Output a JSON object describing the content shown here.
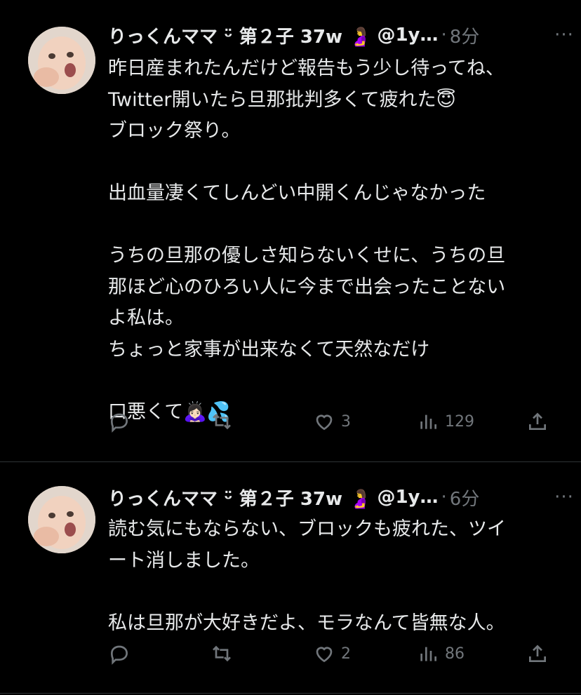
{
  "tweets": [
    {
      "name": "りっくんママ ᵕ̈ 第２子 37w 🤰",
      "handle": "@1y…",
      "dot": "·",
      "time": "8分",
      "more": "···",
      "lines": [
        "昨日産まれたんだけど報告もう少し待ってね、",
        "Twitter開いたら旦那批判多くて疲れた😇",
        "ブロック祭り。",
        "",
        "出血量凄くてしんどい中開くんじゃなかった",
        "",
        "うちの旦那の優しさ知らないくせに、うちの旦",
        "那ほど心のひろい人に今まで出会ったことない",
        "よ私は。",
        "ちょっと家事が出来なくて天然なだけ",
        "",
        "口悪くて🙇🏻‍♀️💦"
      ],
      "replies": "",
      "retweets": "",
      "likes": "3",
      "views": "129"
    },
    {
      "name": "りっくんママ ᵕ̈ 第２子 37w 🤰",
      "handle": "@1y…",
      "dot": "·",
      "time": "6分",
      "more": "···",
      "lines": [
        "読む気にもならない、ブロックも疲れた、ツイ",
        "ート消しました。",
        "",
        "私は旦那が大好きだよ、モラなんて皆無な人。"
      ],
      "replies": "",
      "retweets": "",
      "likes": "2",
      "views": "86"
    }
  ]
}
